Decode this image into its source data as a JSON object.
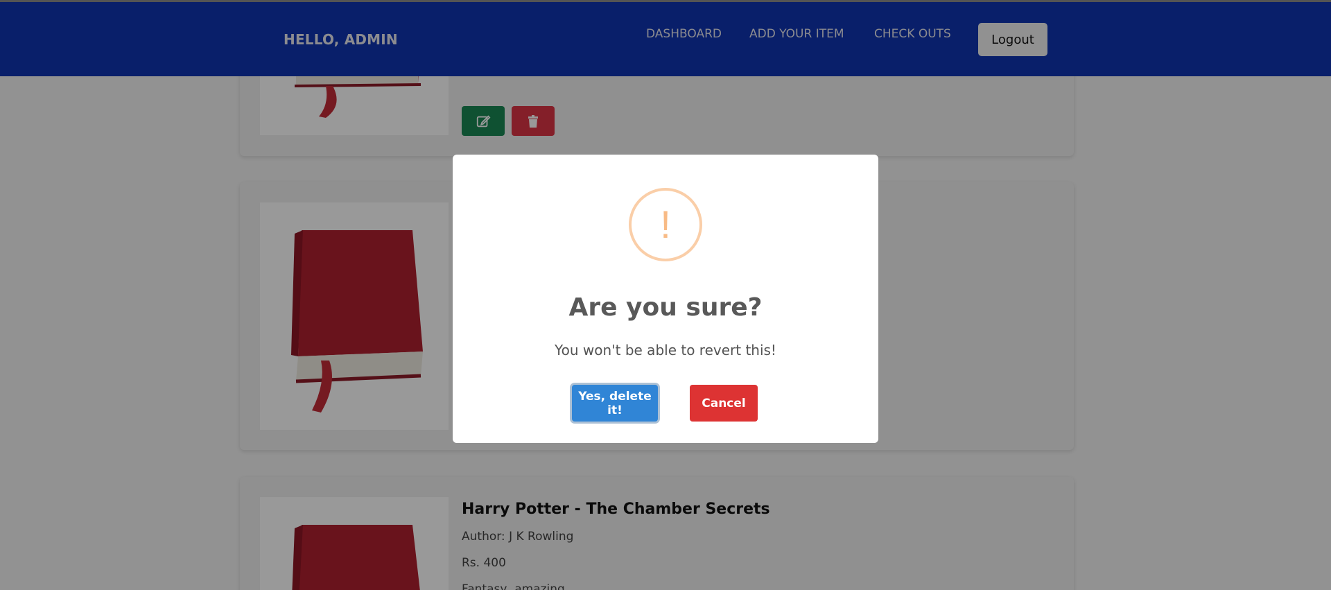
{
  "navbar": {
    "brand": "HELLO, ADMIN",
    "links": [
      {
        "label": "DASHBOARD"
      },
      {
        "label": "ADD YOUR ITEM"
      },
      {
        "label": "CHECK OUTS"
      }
    ],
    "logout_label": "Logout",
    "color": "#1035b1"
  },
  "books": [
    {
      "title": "",
      "author": "",
      "price": "",
      "tags": ""
    },
    {
      "title": "",
      "author": "",
      "price": "",
      "tags": ""
    },
    {
      "title": "Harry Potter - The Chamber Secrets",
      "author": "Author: J K Rowling",
      "price": "Rs. 400",
      "tags": "Fantasy, amazing"
    }
  ],
  "actions": {
    "edit_icon": "edit-icon",
    "delete_icon": "trash-icon",
    "edit_color": "#198754",
    "delete_color": "#dc3545"
  },
  "modal": {
    "icon": "!",
    "title": "Are you sure?",
    "text": "You won't be able to revert this!",
    "confirm_label": "Yes, delete it!",
    "cancel_label": "Cancel",
    "confirm_color": "#3085d6",
    "cancel_color": "#dd3333",
    "icon_color": "#f8bb86"
  }
}
